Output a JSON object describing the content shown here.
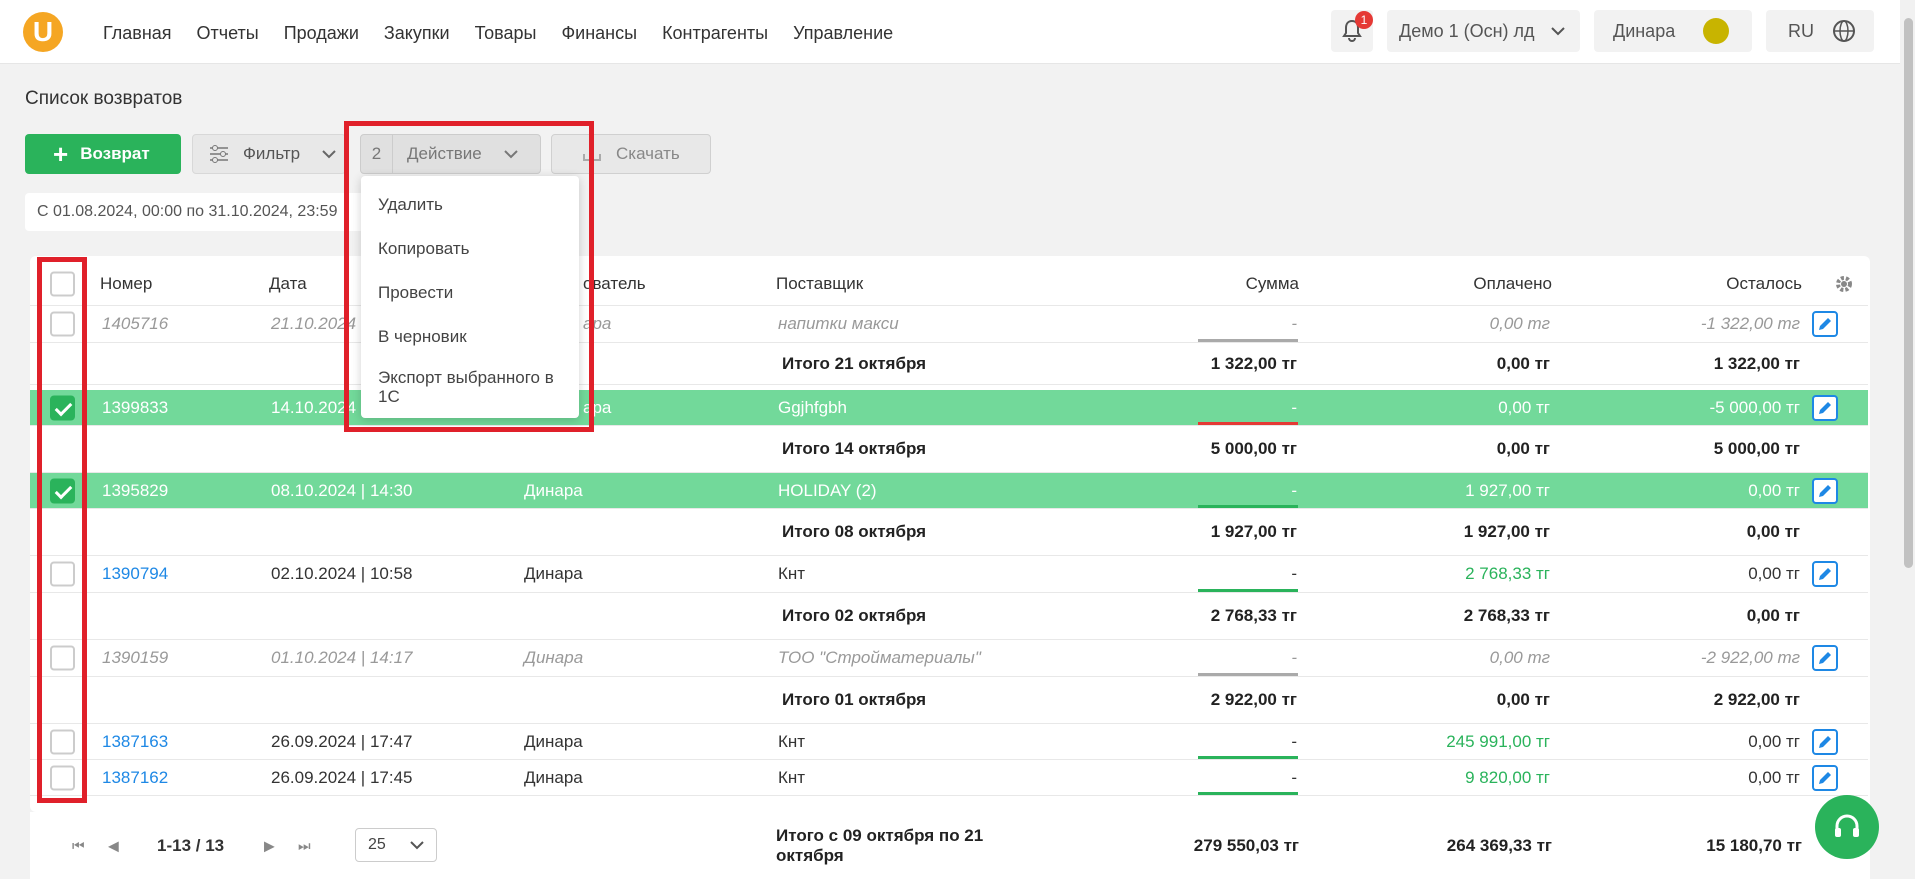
{
  "header": {
    "logo": "U",
    "menu": [
      "Главная",
      "Отчеты",
      "Продажи",
      "Закупки",
      "Товары",
      "Финансы",
      "Контрагенты",
      "Управление"
    ],
    "notifications": "1",
    "org": "Демо 1 (Осн) лд",
    "user": "Динара",
    "lang": "RU"
  },
  "page": {
    "title": "Список возвратов"
  },
  "toolbar": {
    "return_label": "Возврат",
    "filter_label": "Фильтр",
    "selected_count": "2",
    "action_label": "Действие",
    "download_label": "Скачать"
  },
  "date_filter": "С 01.08.2024, 00:00 по 31.10.2024, 23:59",
  "actions_menu": [
    "Удалить",
    "Копировать",
    "Провести",
    "В черновик",
    "Экспорт выбранного в 1С"
  ],
  "table": {
    "headers": {
      "number": "Номер",
      "date": "Дата",
      "user": "ователь",
      "supplier": "Поставщик",
      "sum": "Сумма",
      "paid": "Оплачено",
      "left": "Осталось"
    },
    "rows": [
      {
        "number": "1405716",
        "date": "21.10.2024",
        "user": "ара",
        "supplier": "напитки макси",
        "sum": "-",
        "paid": "0,00 тг",
        "left": "-1 322,00 тг"
      },
      {
        "total": "Итого 21 октября",
        "sum": "1 322,00 тг",
        "paid": "0,00 тг",
        "left": "1 322,00 тг"
      },
      {
        "number": "1399833",
        "date": "14.10.2024",
        "user": "ара",
        "supplier": "Ggjhfgbh",
        "sum": "-",
        "paid": "0,00 тг",
        "left": "-5 000,00 тг"
      },
      {
        "total": "Итого 14 октября",
        "sum": "5 000,00 тг",
        "paid": "0,00 тг",
        "left": "5 000,00 тг"
      },
      {
        "number": "1395829",
        "date": "08.10.2024 | 14:30",
        "user": "Динара",
        "supplier": "HOLIDAY (2)",
        "sum": "-",
        "paid": "1 927,00 тг",
        "left": "0,00 тг"
      },
      {
        "total": "Итого 08 октября",
        "sum": "1 927,00 тг",
        "paid": "1 927,00 тг",
        "left": "0,00 тг"
      },
      {
        "number": "1390794",
        "date": "02.10.2024 | 10:58",
        "user": "Динара",
        "supplier": "Кнт",
        "sum": "-",
        "paid": "2 768,33 тг",
        "left": "0,00 тг"
      },
      {
        "total": "Итого 02 октября",
        "sum": "2 768,33 тг",
        "paid": "2 768,33 тг",
        "left": "0,00 тг"
      },
      {
        "number": "1390159",
        "date": "01.10.2024 | 14:17",
        "user": "Динара",
        "supplier": "ТОО \"Стройматериалы\"",
        "sum": "-",
        "paid": "0,00 тг",
        "left": "-2 922,00 тг"
      },
      {
        "total": "Итого 01 октября",
        "sum": "2 922,00 тг",
        "paid": "0,00 тг",
        "left": "2 922,00 тг"
      },
      {
        "number": "1387163",
        "date": "26.09.2024 | 17:47",
        "user": "Динара",
        "supplier": "Кнт",
        "sum": "-",
        "paid": "245 991,00 тг",
        "left": "0,00 тг"
      },
      {
        "number": "1387162",
        "date": "26.09.2024 | 17:45",
        "user": "Динара",
        "supplier": "Кнт",
        "sum": "-",
        "paid": "9 820,00 тг",
        "left": "0,00 тг"
      }
    ]
  },
  "footer": {
    "range": "1-13 / 13",
    "per_page": "25",
    "total_label": "Итого с 09 октября по 21 октября",
    "sum": "279 550,03 тг",
    "paid": "264 369,33 тг",
    "left": "15 180,70 тг"
  }
}
